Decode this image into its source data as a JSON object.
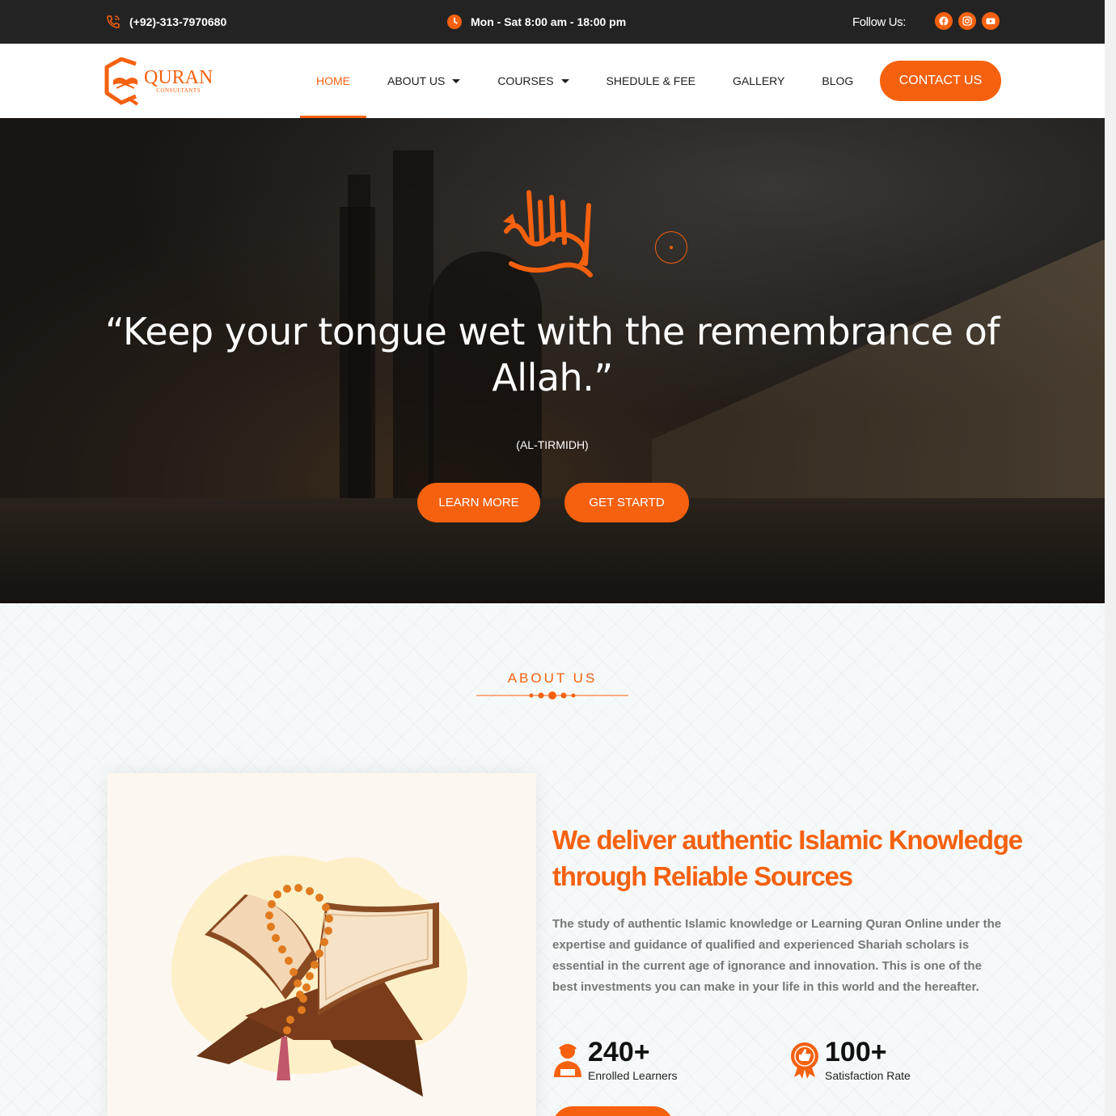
{
  "topbar": {
    "phone": "(+92)-313-7970680",
    "hours": "Mon - Sat 8:00 am - 18:00 pm",
    "follow_label": "Follow Us:",
    "socials": [
      "facebook-icon",
      "instagram-icon",
      "youtube-icon"
    ]
  },
  "brand": {
    "name": "QURAN",
    "tagline": "CONSULTANTS",
    "accent_color": "#f5610f"
  },
  "nav": {
    "items": [
      {
        "label": "HOME"
      },
      {
        "label": "ABOUT US"
      },
      {
        "label": "COURSES"
      },
      {
        "label": "SHEDULE & FEE"
      },
      {
        "label": "GALLERY"
      },
      {
        "label": "BLOG"
      }
    ],
    "contact_label": "CONTACT US"
  },
  "hero": {
    "quote": "“Keep your tongue wet with the remembrance of Allah.”",
    "source": "(AL-TIRMIDH)",
    "learn_more": "LEARN MORE",
    "get_started": "GET STARTD"
  },
  "about": {
    "kicker": "ABOUT US",
    "heading": "We deliver authentic Islamic Knowledge through Reliable Sources",
    "body": "The study of authentic Islamic knowledge or Learning Quran Online under the expertise and guidance of qualified and experienced Shariah scholars is essential in the current age of ignorance and innovation. This is one of the best investments you can make in your life in this world and the hereafter.",
    "stats": [
      {
        "value": "240+",
        "label": "Enrolled Learners",
        "icon": "learner-icon"
      },
      {
        "value": "100+",
        "label": "Satisfaction Rate",
        "icon": "satisfaction-badge-icon"
      }
    ]
  }
}
